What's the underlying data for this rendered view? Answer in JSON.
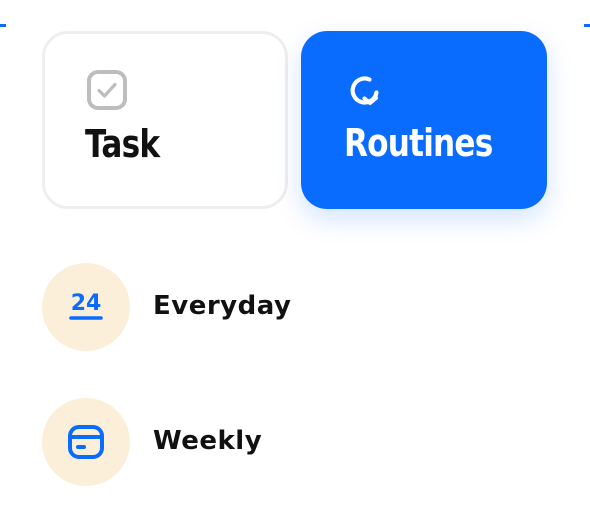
{
  "colors": {
    "accent": "#0a6cff",
    "card_border": "#eeeeee",
    "option_circle": "#fcefd9",
    "text_dark": "#111111",
    "icon_gray": "#bdbdbd"
  },
  "type_selector": {
    "task": {
      "label": "Task",
      "icon": "checkbox-icon",
      "selected": false
    },
    "routines": {
      "label": "Routines",
      "icon": "refresh-icon",
      "selected": true
    }
  },
  "frequency_options": {
    "everyday": {
      "label": "Everyday",
      "icon": "calendar-24-icon",
      "icon_text": "24"
    },
    "weekly": {
      "label": "Weekly",
      "icon": "calendar-icon"
    }
  }
}
